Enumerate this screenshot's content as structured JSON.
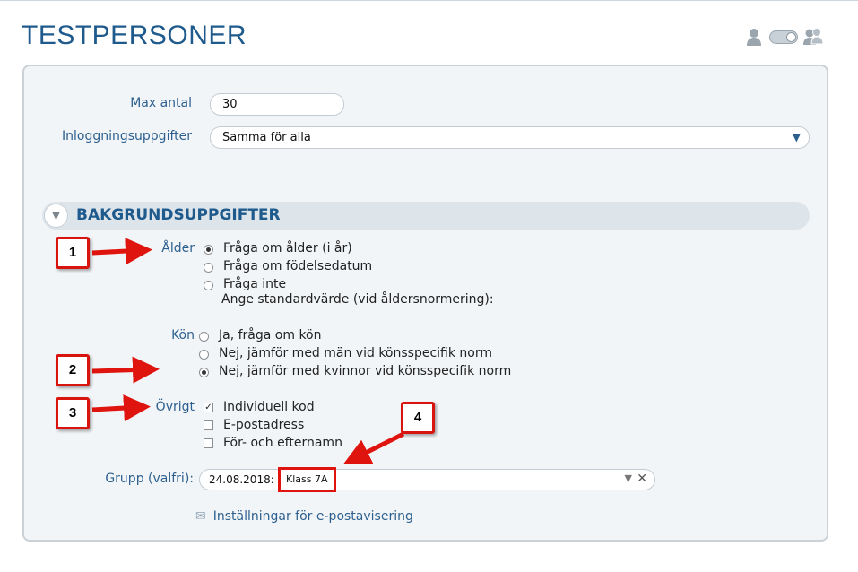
{
  "page": {
    "title": "TESTPERSONER"
  },
  "top_icons": [
    "user-icon",
    "toggle-switch",
    "group-users-icon"
  ],
  "settings": {
    "max_label": "Max antal",
    "max_value": "30",
    "login_label": "Inloggningsuppgifter",
    "login_value": "Samma för alla",
    "login_arrow": "▼"
  },
  "section": {
    "chevron": "▼",
    "title": "BAKGRUNDSUPPGIFTER"
  },
  "age": {
    "label": "Ålder",
    "options": [
      "Fråga om ålder (i år)",
      "Fråga om födelsedatum",
      "Fråga inte"
    ],
    "selected_index": 0,
    "default_text": "Ange standardvärde (vid åldersnormering):"
  },
  "gender": {
    "label": "Kön",
    "options": [
      "Ja, fråga om kön",
      "Nej, jämför med män vid könsspecifik norm",
      "Nej, jämför med kvinnor vid könsspecifik norm"
    ],
    "selected_index": 2
  },
  "other": {
    "label": "Övrigt",
    "options": [
      "Individuell kod",
      "E-postadress",
      "För- och efternamn"
    ],
    "checked": [
      true,
      false,
      false
    ],
    "check_mark": "✓"
  },
  "group": {
    "label": "Grupp (valfri):",
    "date": "24.08.2018:",
    "tag": "Klass 7A",
    "arrow": "▼",
    "clear": "✕"
  },
  "email_link": {
    "icon": "envelope-icon",
    "envelope_glyph": "✉",
    "text": "Inställningar för e-postavisering"
  },
  "callouts": [
    "1",
    "2",
    "3",
    "4"
  ],
  "colors": {
    "title": "#1f5a8c",
    "accent": "#2c5f8e",
    "panel_bg": "#f2f5f8",
    "callout_red": "#d9140f"
  }
}
